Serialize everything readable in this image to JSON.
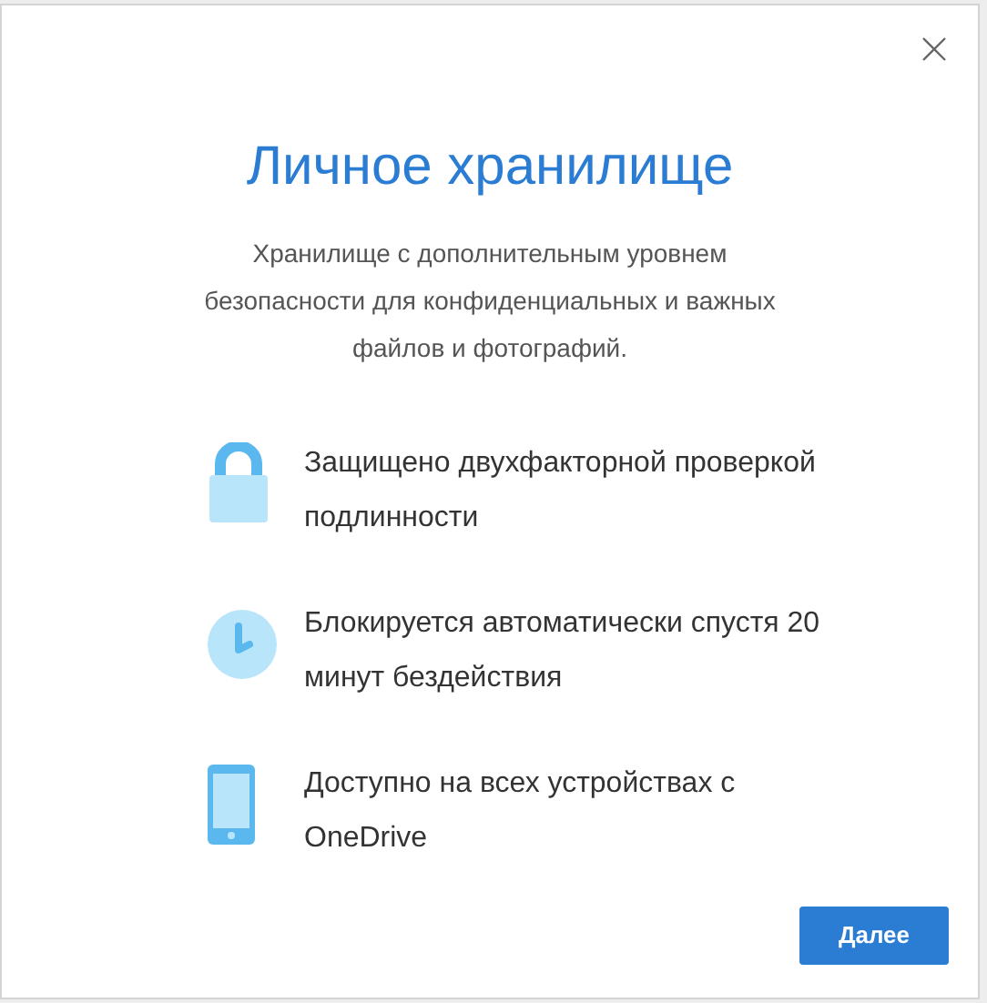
{
  "dialog": {
    "title": "Личное хранилище",
    "description": "Хранилище с дополнительным уровнем безопасности для конфиденциальных и важных файлов и фотографий.",
    "features": [
      {
        "kind": "lock",
        "text": "Защищено двухфакторной проверкой подлинности"
      },
      {
        "kind": "clock",
        "text": "Блокируется автоматически спустя 20 минут бездействия"
      },
      {
        "kind": "phone",
        "text": "Доступно на всех устройствах с OneDrive"
      }
    ],
    "next_button": "Далее"
  }
}
